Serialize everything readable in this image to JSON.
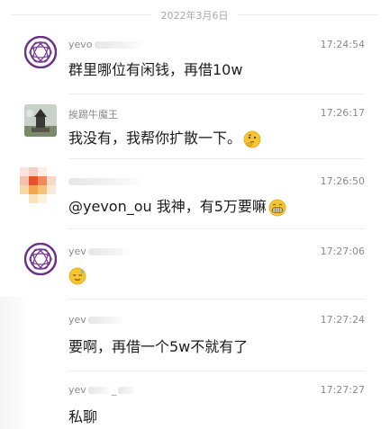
{
  "date": "2022年3月6日",
  "messages": [
    {
      "name": "yevo",
      "time": "17:24:54",
      "text": "群里哪位有闲钱，再借10w",
      "avatar_icon": "purple-ring-logo"
    },
    {
      "name": "挨踢牛魔王",
      "time": "17:26:17",
      "text": "我没有，我帮你扩散一下。",
      "emoji": "thinking-face-emoji",
      "avatar_icon": "statue-photo"
    },
    {
      "name": "",
      "time": "17:26:50",
      "text": "@yevon_ou 我神，有5万要嘛",
      "emoji": "grinning-face-emoji",
      "avatar_icon": "pixelated-avatar"
    },
    {
      "name": "yev",
      "time": "17:27:06",
      "text": "",
      "emoji": "sweat-smile-emoji",
      "avatar_icon": "purple-ring-logo"
    },
    {
      "name": "yev",
      "time": "17:27:24",
      "text": "要啊，再借一个5w不就有了"
    },
    {
      "name": "yev",
      "name_suffix": "_",
      "time": "17:27:27",
      "text": "私聊"
    }
  ],
  "colors": {
    "accent_purple": "#6b2f87",
    "text": "#1b1b1b",
    "meta": "#8b8b8b",
    "emoji_yellow": "#f7c531"
  }
}
